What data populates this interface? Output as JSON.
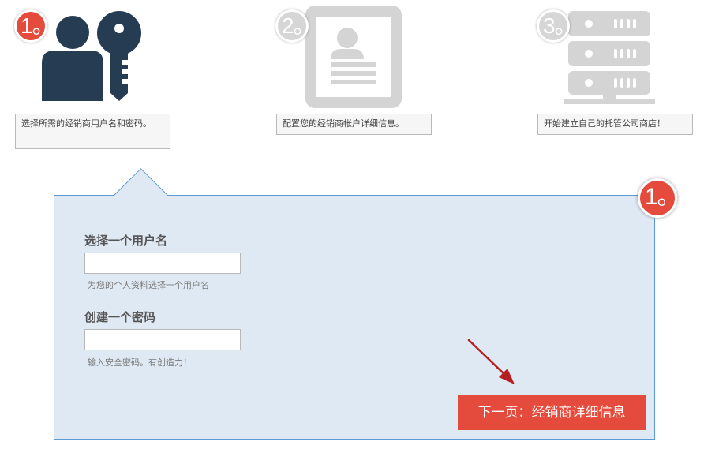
{
  "steps": [
    {
      "badge": "1。",
      "caption": "选择所需的经销商用户名和密码。",
      "icon": "user-key-icon",
      "state": "active"
    },
    {
      "badge": "2。",
      "caption": "配置您的经销商帐户详细信息。",
      "icon": "profile-document-icon",
      "state": "inactive"
    },
    {
      "badge": "3。",
      "caption": "开始建立自己的托管公司商店！",
      "icon": "server-rack-icon",
      "state": "inactive"
    }
  ],
  "panel": {
    "badge": "1。",
    "username": {
      "label": "选择一个用户名",
      "value": "",
      "placeholder": "",
      "hint": "为您的个人资料选择一个用户名"
    },
    "password": {
      "label": "创建一个密码",
      "value": "",
      "placeholder": "",
      "hint": "输入安全密码。有创造力！"
    },
    "next_label": "下一页：经销商详细信息"
  },
  "colors": {
    "accent": "#e54b3c",
    "icon_active": "#263c53",
    "icon_inactive": "#d4d4d4",
    "panel_bg": "#dfe9f3",
    "panel_border": "#5b9bd5",
    "arrow": "#b51f1f"
  }
}
